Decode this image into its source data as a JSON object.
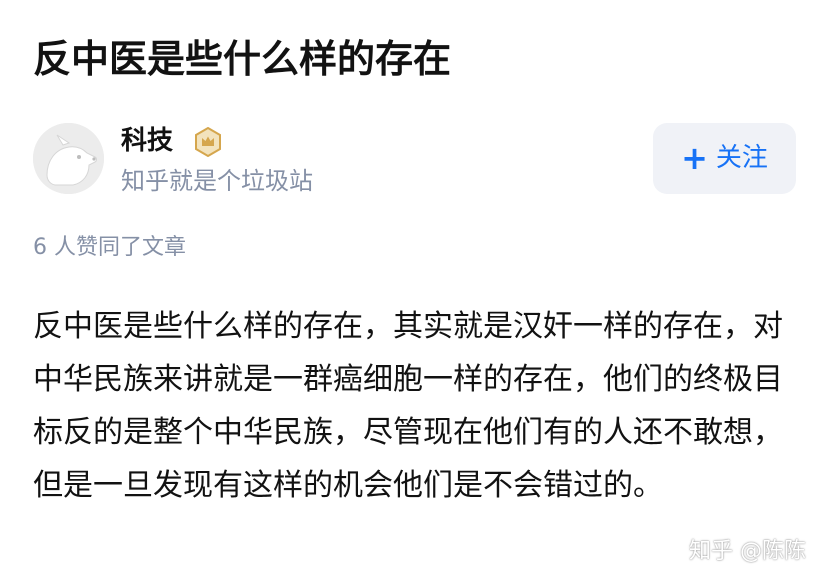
{
  "post": {
    "title": "反中医是些什么样的存在"
  },
  "author": {
    "name": "科技",
    "bio": "知乎就是个垃圾站",
    "avatar_icon": "dog-avatar-icon",
    "badge_icon": "crown-badge-icon"
  },
  "follow_button": {
    "plus": "+",
    "label": "关注"
  },
  "likes_text": "6 人赞同了文章",
  "content_text": "反中医是些什么样的存在，其实就是汉奸一样的存在，对中华民族来讲就是一群癌细胞一样的存在，他们的终极目标反的是整个中华民族，尽管现在他们有的人还不敢想，但是一旦发现有这样的机会他们是不会错过的。",
  "watermark": "知乎 @陈陈",
  "colors": {
    "accent": "#1772f6",
    "follow_bg": "#f0f2f7",
    "muted_text": "#8590a6",
    "badge_gold": "#d5a64d"
  }
}
